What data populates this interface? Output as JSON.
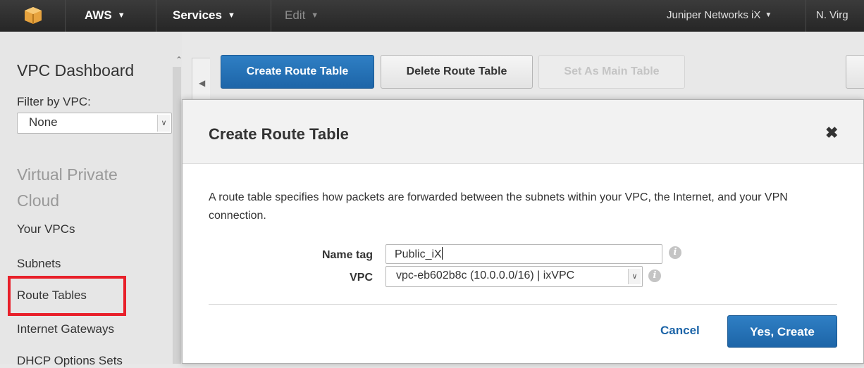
{
  "topbar": {
    "logo_icon": "aws-cube-icon",
    "aws_label": "AWS",
    "services_label": "Services",
    "edit_label": "Edit",
    "account_label": "Juniper Networks iX",
    "region_label": "N. Virg"
  },
  "sidebar": {
    "title": "VPC Dashboard",
    "filter_label": "Filter by VPC:",
    "filter_value": "None",
    "section_title": "Virtual Private Cloud",
    "items": [
      {
        "label": "Your VPCs"
      },
      {
        "label": "Subnets"
      },
      {
        "label": "Route Tables"
      },
      {
        "label": "Internet Gateways"
      },
      {
        "label": "DHCP Options Sets"
      }
    ],
    "highlight_color": "#e8202a"
  },
  "toolbar": {
    "create_label": "Create Route Table",
    "delete_label": "Delete Route Table",
    "set_main_label": "Set As Main Table"
  },
  "modal": {
    "title": "Create Route Table",
    "close_symbol": "✖",
    "description": "A route table specifies how packets are forwarded between the subnets within your VPC, the Internet, and your VPN connection.",
    "name_tag_label": "Name tag",
    "name_tag_value": "Public_iX",
    "vpc_label": "VPC",
    "vpc_value": "vpc-eb602b8c (10.0.0.0/16) | ixVPC",
    "cancel_label": "Cancel",
    "submit_label": "Yes, Create"
  },
  "colors": {
    "primary": "#1d65a8",
    "topbar": "#262626"
  }
}
